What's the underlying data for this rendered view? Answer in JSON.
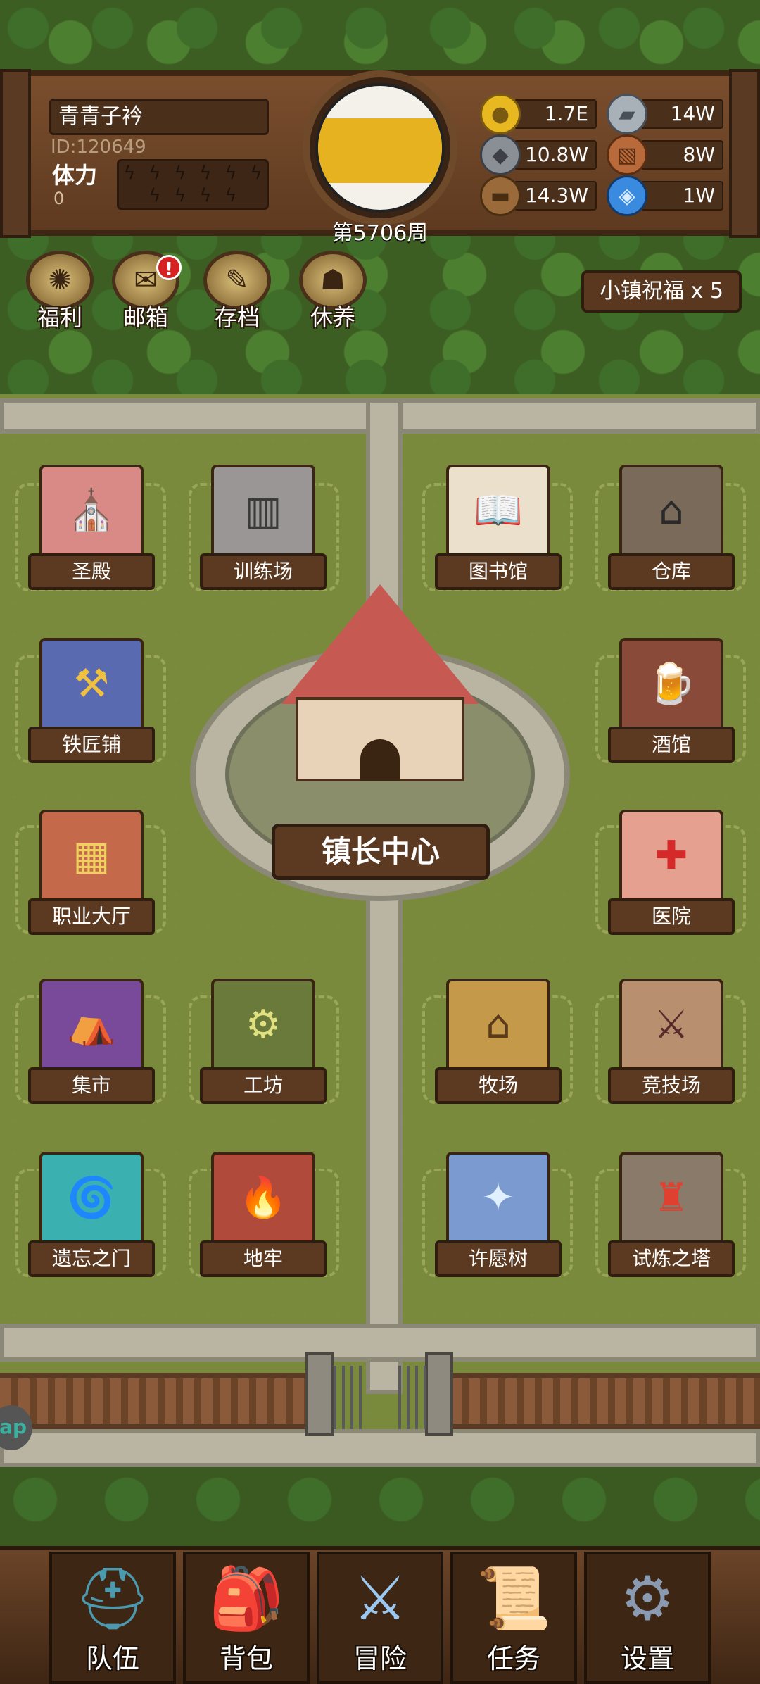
{
  "player": {
    "name": "青青子衿",
    "id": "ID:120649",
    "stamina_label": "体力",
    "stamina_value": "0",
    "stamina_slots": [
      "ϟ",
      "ϟ",
      "ϟ",
      "ϟ",
      "ϟ",
      "ϟ",
      "ϟ",
      "ϟ",
      "ϟ",
      "ϟ"
    ]
  },
  "clock": {
    "week_label": "第5706周"
  },
  "resources": [
    {
      "name": "gold-coin-icon",
      "value": "1.7E",
      "color": "#e8b820"
    },
    {
      "name": "iron-ingot-icon",
      "value": "14W",
      "color": "#a8b0b8"
    },
    {
      "name": "stone-ore-icon",
      "value": "10.8W",
      "color": "#8a8f96"
    },
    {
      "name": "leather-hide-icon",
      "value": "8W",
      "color": "#b86a3a"
    },
    {
      "name": "wood-log-icon",
      "value": "14.3W",
      "color": "#9a6a3a"
    },
    {
      "name": "crystal-icon",
      "value": "1W",
      "color": "#3a8ae0"
    }
  ],
  "shortcuts": [
    {
      "label": "福利",
      "icon": "wheel-icon"
    },
    {
      "label": "邮箱",
      "icon": "mail-icon"
    },
    {
      "label": "存档",
      "icon": "scroll-quill-icon"
    },
    {
      "label": "休养",
      "icon": "rest-scroll-icon"
    }
  ],
  "mail_badge": "!",
  "blessing": "小镇祝福 x 5",
  "buildings": {
    "sanctuary": "圣殿",
    "training": "训练场",
    "library": "图书馆",
    "warehouse": "仓库",
    "blacksmith": "铁匠铺",
    "tavern": "酒馆",
    "guild": "职业大厅",
    "hospital": "医院",
    "market": "集市",
    "workshop": "工坊",
    "ranch": "牧场",
    "arena": "竞技场",
    "portal": "遗忘之门",
    "dungeon": "地牢",
    "wishtree": "许愿树",
    "tower": "试炼之塔",
    "townhall": "镇长中心"
  },
  "side_tab": "ap",
  "nav": [
    {
      "label": "队伍",
      "icon": "helmet-icon"
    },
    {
      "label": "背包",
      "icon": "backpack-icon"
    },
    {
      "label": "冒险",
      "icon": "crossed-swords-icon"
    },
    {
      "label": "任务",
      "icon": "quest-scroll-icon"
    },
    {
      "label": "设置",
      "icon": "gears-icon"
    }
  ]
}
